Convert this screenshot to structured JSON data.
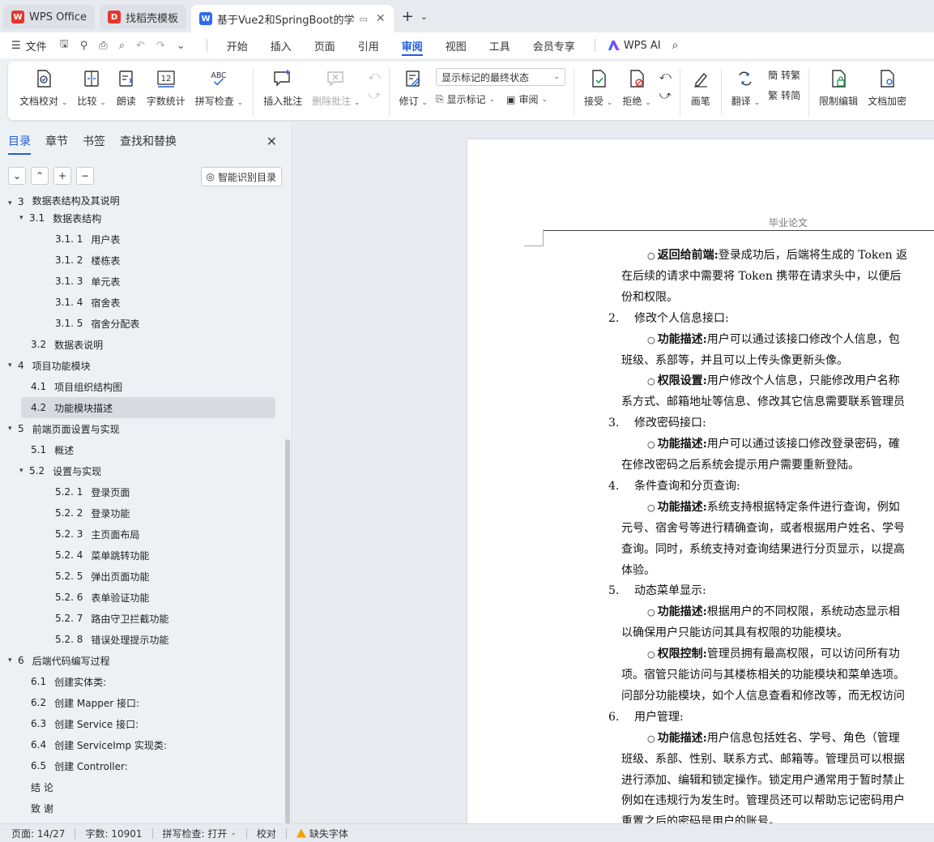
{
  "tabs": [
    {
      "label": "WPS Office",
      "logo": "W",
      "color": "#e8362d"
    },
    {
      "label": "找稻壳模板",
      "logo": "D",
      "color": "#e8362d"
    },
    {
      "label": "基于Vue2和SpringBoot的学",
      "logo": "W",
      "color": "#2f6bf0"
    }
  ],
  "menubar": {
    "file_label": "文件",
    "items": [
      "开始",
      "插入",
      "页面",
      "引用",
      "审阅",
      "视图",
      "工具",
      "会员专享"
    ],
    "active": "审阅",
    "ai_label": "WPS AI"
  },
  "ribbon": {
    "doc_check": "文档校对",
    "compare": "比较",
    "read_aloud": "朗读",
    "word_count": "字数统计",
    "spell_check": "拼写检查",
    "insert_comment": "插入批注",
    "delete_comment": "删除批注",
    "revise": "修订",
    "markup_mode": "显示标记的最终状态",
    "show_markup": "显示标记",
    "review": "审阅",
    "accept": "接受",
    "reject": "拒绝",
    "pen": "画笔",
    "translate": "翻译",
    "to_traditional": "转繁",
    "to_simplified": "转简",
    "restrict_edit": "限制编辑",
    "doc_encrypt": "文档加密",
    "icon_text_abc": "ABC",
    "icon_text_12": "12"
  },
  "sidebar": {
    "tabs": [
      "目录",
      "章节",
      "书签",
      "查找和替换"
    ],
    "active_tab": "目录",
    "smart_toc": "智能识别目录",
    "toc": [
      {
        "level": 1,
        "num": "3",
        "text": "数据表结构及其说明",
        "arrow": "▾",
        "partial": true
      },
      {
        "level": 2,
        "num": "3.1",
        "text": "数据表结构",
        "arrow": "▾"
      },
      {
        "level": 3,
        "num": "3.1. 1",
        "text": "用户表"
      },
      {
        "level": 3,
        "num": "3.1. 2",
        "text": "楼栋表"
      },
      {
        "level": 3,
        "num": "3.1. 3",
        "text": "单元表"
      },
      {
        "level": 3,
        "num": "3.1. 4",
        "text": "宿舍表"
      },
      {
        "level": 3,
        "num": "3.1. 5",
        "text": "宿舍分配表"
      },
      {
        "level": 2,
        "num": "3.2",
        "text": "数据表说明"
      },
      {
        "level": 1,
        "num": "4",
        "text": "项目功能模块",
        "arrow": "▾"
      },
      {
        "level": 2,
        "num": "4.1",
        "text": "项目组织结构图"
      },
      {
        "level": 2,
        "num": "4.2",
        "text": "功能模块描述",
        "selected": true
      },
      {
        "level": 1,
        "num": "5",
        "text": "前端页面设置与实现",
        "arrow": "▾"
      },
      {
        "level": 2,
        "num": "5.1",
        "text": "概述"
      },
      {
        "level": 2,
        "num": "5.2",
        "text": "设置与实现",
        "arrow": "▾"
      },
      {
        "level": 3,
        "num": "5.2. 1",
        "text": "登录页面"
      },
      {
        "level": 3,
        "num": "5.2. 2",
        "text": "登录功能"
      },
      {
        "level": 3,
        "num": "5.2. 3",
        "text": "主页面布局"
      },
      {
        "level": 3,
        "num": "5.2. 4",
        "text": "菜单跳转功能"
      },
      {
        "level": 3,
        "num": "5.2. 5",
        "text": "弹出页面功能"
      },
      {
        "level": 3,
        "num": "5.2. 6",
        "text": "表单验证功能"
      },
      {
        "level": 3,
        "num": "5.2. 7",
        "text": "路由守卫拦截功能"
      },
      {
        "level": 3,
        "num": "5.2. 8",
        "text": "错误处理提示功能"
      },
      {
        "level": 1,
        "num": "6",
        "text": "后端代码编写过程",
        "arrow": "▾"
      },
      {
        "level": 2,
        "num": "6.1",
        "text": "创建实体类:"
      },
      {
        "level": 2,
        "num": "6.2",
        "text": "创建 Mapper 接口:"
      },
      {
        "level": 2,
        "num": "6.3",
        "text": "创建 Service 接口:"
      },
      {
        "level": 2,
        "num": "6.4",
        "text": "创建 ServiceImp 实现类:"
      },
      {
        "level": 2,
        "num": "6.5",
        "text": "创建 Controller:"
      },
      {
        "level": 0,
        "num": "",
        "text": "结    论"
      },
      {
        "level": 0,
        "num": "",
        "text": "致    谢"
      }
    ]
  },
  "document": {
    "header": "毕业论文",
    "lines": [
      {
        "indent": 2,
        "bullet": "○",
        "bold": "返回给前端:",
        "text": "登录成功后，后端将生成的 Token 返"
      },
      {
        "indent": 1,
        "text": "在后续的请求中需要将 Token 携带在请求头中，以便后"
      },
      {
        "indent": 1,
        "text": "份和权限。"
      },
      {
        "indent": 0,
        "num": "2.",
        "text": "修改个人信息接口:"
      },
      {
        "indent": 2,
        "bullet": "○",
        "bold": "功能描述:",
        "text": "用户可以通过该接口修改个人信息，包"
      },
      {
        "indent": 1,
        "text": "班级、系部等，并且可以上传头像更新头像。"
      },
      {
        "indent": 2,
        "bullet": "○",
        "bold": "权限设置:",
        "text": "用户修改个人信息，只能修改用户名称"
      },
      {
        "indent": 1,
        "text": "系方式、邮箱地址等信息、修改其它信息需要联系管理员"
      },
      {
        "indent": 0,
        "num": "3.",
        "text": "修改密码接口:"
      },
      {
        "indent": 2,
        "bullet": "○",
        "bold": "功能描述:",
        "text": "用户可以通过该接口修改登录密码，確"
      },
      {
        "indent": 1,
        "text": "在修改密码之后系统会提示用户需要重新登陆。"
      },
      {
        "indent": 0,
        "num": "4.",
        "text": "条件查询和分页查询:"
      },
      {
        "indent": 2,
        "bullet": "○",
        "bold": "功能描述:",
        "text": "系统支持根据特定条件进行查询，例如"
      },
      {
        "indent": 1,
        "text": "元号、宿舍号等进行精确查询，或者根据用户姓名、学号"
      },
      {
        "indent": 1,
        "text": "查询。同时，系统支持对查询结果进行分页显示，以提高"
      },
      {
        "indent": 1,
        "text": "体验。"
      },
      {
        "indent": 0,
        "num": "5.",
        "text": "动态菜单显示:"
      },
      {
        "indent": 2,
        "bullet": "○",
        "bold": "功能描述:",
        "text": "根据用户的不同权限，系统动态显示相"
      },
      {
        "indent": 1,
        "text": "以确保用户只能访问其具有权限的功能模块。"
      },
      {
        "indent": 2,
        "bullet": "○",
        "bold": "权限控制:",
        "text": "管理员拥有最高权限，可以访问所有功"
      },
      {
        "indent": 1,
        "text": "项。宿管只能访问与其楼栋相关的功能模块和菜单选项。"
      },
      {
        "indent": 1,
        "text": "问部分功能模块，如个人信息查看和修改等，而无权访问"
      },
      {
        "indent": 0,
        "num": "6.",
        "text": "用户管理:"
      },
      {
        "indent": 2,
        "bullet": "○",
        "bold": "功能描述:",
        "text": "用户信息包括姓名、学号、角色（管理"
      },
      {
        "indent": 1,
        "text": "班级、系部、性别、联系方式、邮箱等。管理员可以根据"
      },
      {
        "indent": 1,
        "text": "进行添加、编辑和锁定操作。锁定用户通常用于暂时禁止"
      },
      {
        "indent": 1,
        "text": "例如在违规行为发生时。管理员还可以帮助忘记密码用户"
      },
      {
        "indent": 1,
        "text": "重置之后的密码是用户的账号。"
      }
    ]
  },
  "statusbar": {
    "page": "页面: 14/27",
    "words": "字数: 10901",
    "spell": "拼写检查: 打开",
    "proof": "校对",
    "missing_font": "缺失字体"
  },
  "colors": {
    "accent": "#1e5fd8",
    "wps_red": "#e8362d",
    "warn": "#f2a400"
  }
}
